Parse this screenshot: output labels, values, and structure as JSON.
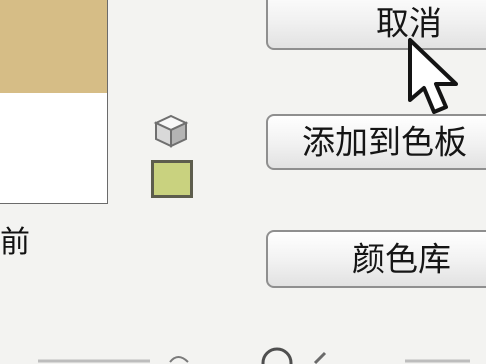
{
  "preview": {
    "new_color": "#d6bd86",
    "current_color": "#ffffff",
    "current_label": "前"
  },
  "websafe": {
    "icon": "cube-icon",
    "swatch_color": "#c9d27f"
  },
  "buttons": {
    "cancel_label": "取消",
    "add_to_swatches_label": "添加到色板",
    "color_libraries_label": "颜色库"
  },
  "cursor": {
    "icon": "arrow-pointer-icon"
  }
}
